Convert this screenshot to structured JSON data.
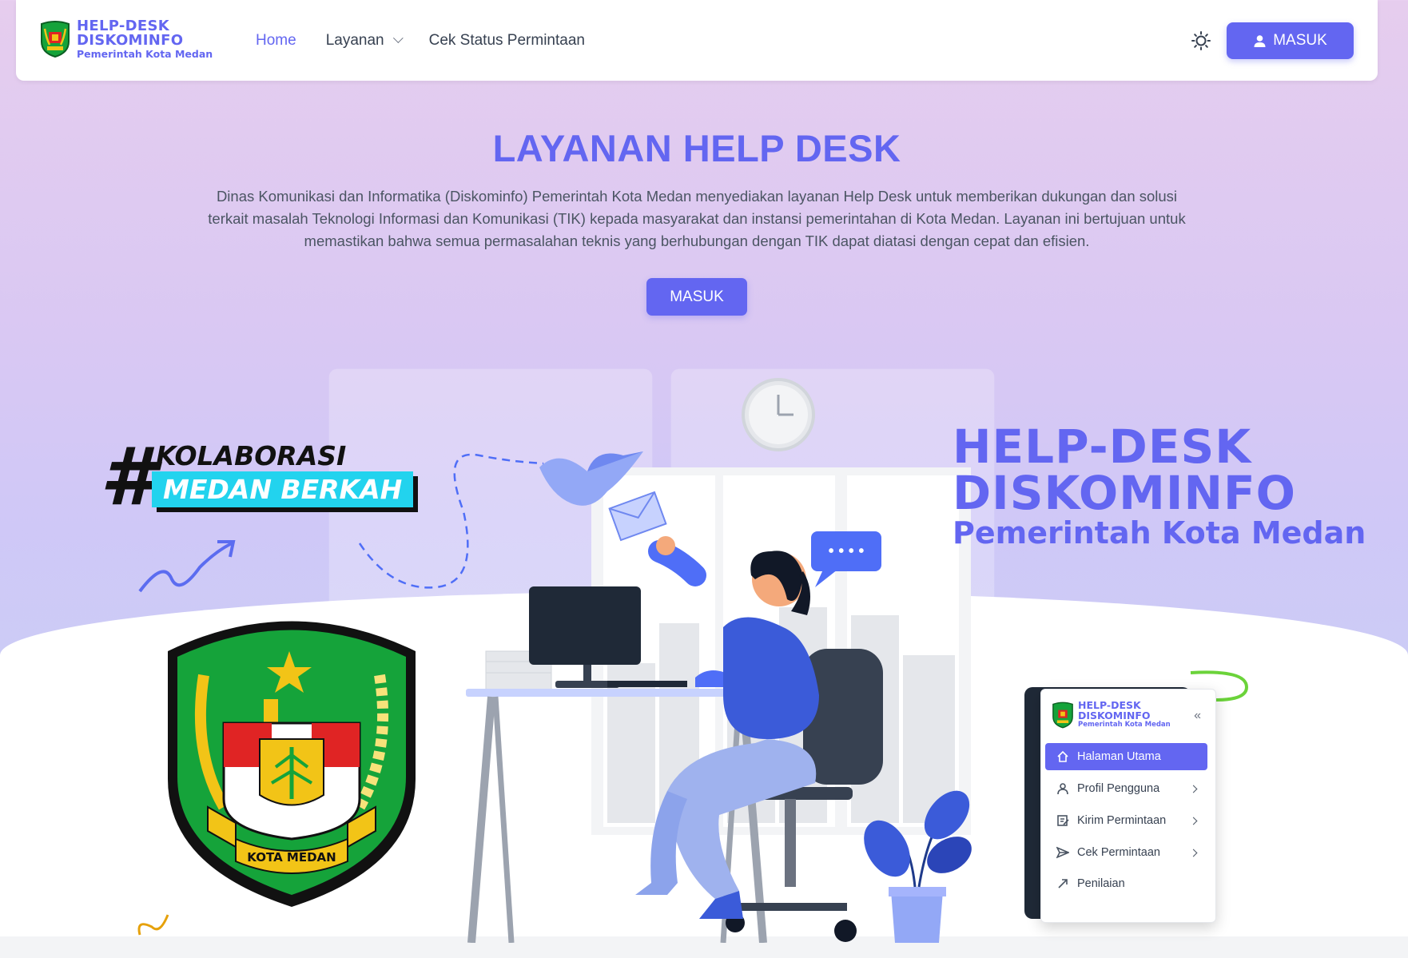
{
  "navbar": {
    "brand": {
      "line1": "HELP-DESK",
      "line2": "DISKOMINFO",
      "line3": "Pemerintah Kota Medan"
    },
    "links": [
      {
        "label": "Home"
      },
      {
        "label": "Layanan"
      },
      {
        "label": "Cek Status Permintaan"
      }
    ],
    "theme_toggle_icon": "sun-icon",
    "login_label": "MASUK"
  },
  "hero": {
    "title": "LAYANAN HELP DESK",
    "description": "Dinas Komunikasi dan Informatika (Diskominfo) Pemerintah Kota Medan menyediakan layanan Help Desk untuk memberikan dukungan dan solusi terkait masalah Teknologi Informasi dan Komunikasi (TIK) kepada masyarakat dan instansi pemerintahan di Kota Medan. Layanan ini bertujuan untuk memastikan bahwa semua permasalahan teknis yang berhubungan dengan TIK dapat diatasi dengan cepat dan efisien.",
    "button_label": "MASUK"
  },
  "illustration": {
    "hashtag": "#",
    "kolab_line1": "KOLABORASI",
    "kolab_line2": "MEDAN BERKAH",
    "big_brand": {
      "line1": "HELP-DESK",
      "line2": "DISKOMINFO",
      "line3": "Pemerintah Kota Medan"
    },
    "emblem_banner": "KOTA MEDAN",
    "chat_dots": "• • • •",
    "mini_sidebar": {
      "brand": {
        "line1": "HELP-DESK",
        "line2": "DISKOMINFO",
        "line3": "Pemerintah Kota Medan"
      },
      "collapse_icon": "double-chevron-left-icon",
      "items": [
        {
          "label": "Halaman Utama",
          "icon": "home-icon"
        },
        {
          "label": "Profil Pengguna",
          "icon": "user-icon"
        },
        {
          "label": "Kirim Permintaan",
          "icon": "edit-icon"
        },
        {
          "label": "Cek Permintaan",
          "icon": "send-icon"
        },
        {
          "label": "Penilaian",
          "icon": "rating-icon"
        }
      ]
    }
  },
  "colors": {
    "primary": "#6366f1",
    "accent_cyan": "#22d3ee",
    "emblem_green": "#15a33a",
    "emblem_gold": "#f2c417"
  }
}
